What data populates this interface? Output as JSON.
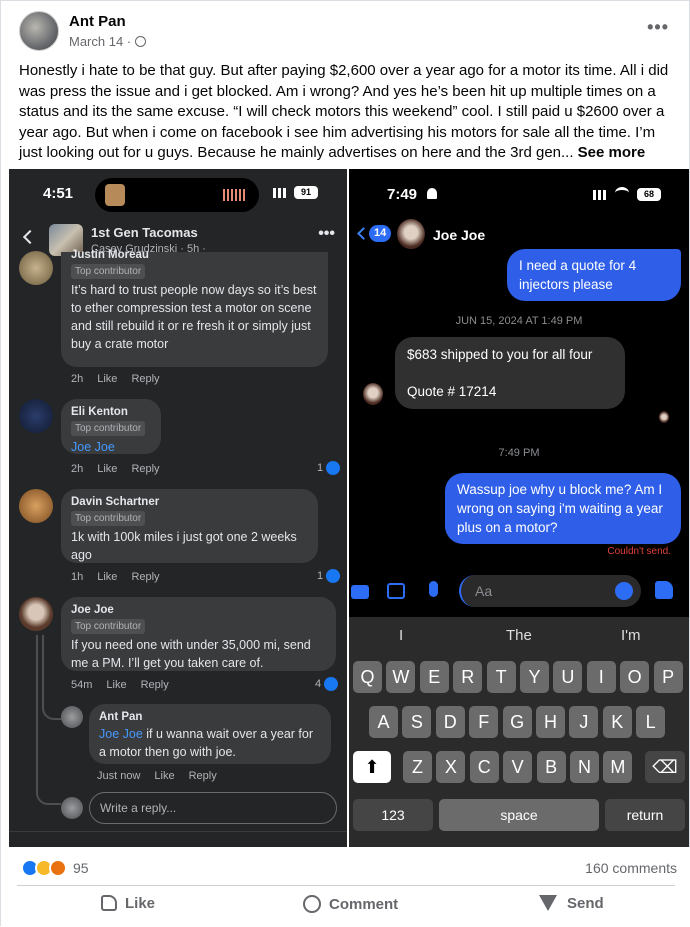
{
  "post": {
    "author": "Ant Pan",
    "date": "March 14 · ",
    "more": "•••",
    "body_text": "Honestly i hate to be that guy. But after paying $2,600 over a year ago for a motor its time. All i did was press the issue and i get blocked. Am i wrong? And yes he’s been hit up multiple times on a status and its the same excuse. “I will check motors this weekend” cool. I still paid u $2600 over a year ago. But when i come on facebook i see him advertising his motors for sale all the time. I’m just looking out for u guys. Because he mainly advertises on here and the 3rd gen... ",
    "see_more": "See more",
    "reactions_count": "95",
    "comments_count": "160 comments",
    "actions": {
      "like": "Like",
      "comment": "Comment",
      "send": "Send"
    }
  },
  "left_shot": {
    "time": "4:51",
    "battery": "91",
    "group_name": "1st Gen Tacomas",
    "group_sub": "Casey Grudzinski · 5h · ",
    "comments": [
      {
        "name": "Justin Moreau",
        "badge": "Top contributor",
        "text": "It’s hard to trust people now days so it’s best to ether compression test a motor on scene and still rebuild it or re fresh it or simply just buy a crate motor",
        "time": "2h",
        "like": "Like",
        "reply": "Reply",
        "likes": ""
      },
      {
        "name": "Eli Kenton",
        "badge": "Top contributor",
        "text": "Joe Joe",
        "time": "2h",
        "like": "Like",
        "reply": "Reply",
        "likes": "1"
      },
      {
        "name": "Davin Schartner",
        "badge": "Top contributor",
        "text": "1k with 100k miles i just got one 2 weeks ago",
        "time": "1h",
        "like": "Like",
        "reply": "Reply",
        "likes": "1"
      },
      {
        "name": "Joe Joe",
        "badge": "Top contributor",
        "text": "If you need one with under 35,000 mi, send me a PM. I’ll get you taken care of.",
        "time": "54m",
        "like": "Like",
        "reply": "Reply",
        "likes": "4"
      }
    ],
    "reply": {
      "name": "Ant Pan",
      "mention": "Joe Joe",
      "text": " if u wanna wait over a year for a motor then go with joe.",
      "time": "Just now",
      "like": "Like",
      "reply": "Reply"
    },
    "reply_placeholder": "Write a reply..."
  },
  "right_shot": {
    "time": "7:49",
    "battery": "68",
    "back_count": "14",
    "contact": "Joe Joe",
    "msg_out_1": "I need a quote for 4 injectors please",
    "date_1": "JUN 15, 2024 AT 1:49 PM",
    "msg_in_1": "$683 shipped to you for all four",
    "msg_in_2": "Quote # 17214",
    "date_2": "7:49 PM",
    "msg_out_2": "Wassup joe why u block me? Am I wrong on saying i'm waiting a year plus on a motor?",
    "error": "Couldn't send.",
    "input_placeholder": "Aa",
    "suggestions": [
      "I",
      "The",
      "I'm"
    ],
    "keys_row1": [
      "Q",
      "W",
      "E",
      "R",
      "T",
      "Y",
      "U",
      "I",
      "O",
      "P"
    ],
    "keys_row2": [
      "A",
      "S",
      "D",
      "F",
      "G",
      "H",
      "J",
      "K",
      "L"
    ],
    "keys_row3": [
      "Z",
      "X",
      "C",
      "V",
      "B",
      "N",
      "M"
    ],
    "key_123": "123",
    "key_space": "space",
    "key_return": "return"
  }
}
